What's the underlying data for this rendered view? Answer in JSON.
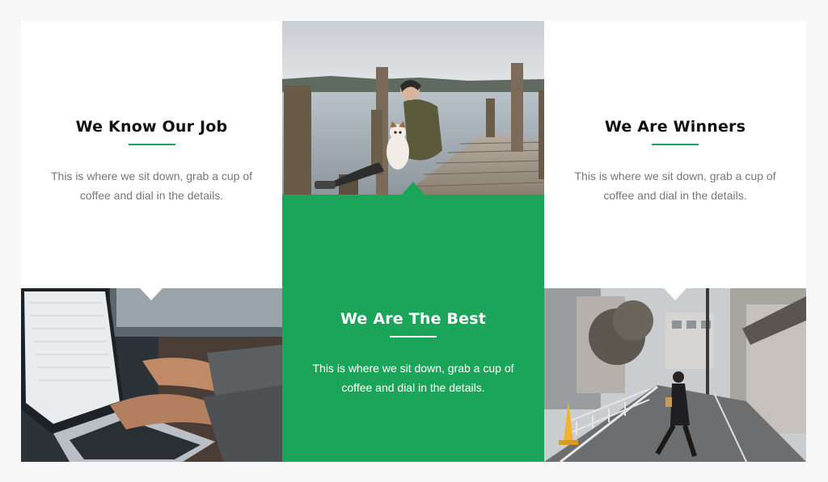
{
  "colors": {
    "accent": "#1aa55a",
    "page_bg": "#f7f7f7"
  },
  "cards": [
    {
      "title": "We Know Our Job",
      "text": "This is where we sit down, grab a cup of coffee and dial in the details."
    },
    {
      "title": "We Are The Best",
      "text": "This is where we sit down, grab a cup of coffee and dial in the details."
    },
    {
      "title": "We Are Winners",
      "text": "This is where we sit down, grab a cup of coffee and dial in the details."
    }
  ],
  "images": {
    "pier": "photo of a person and a dog sitting on a wooden pier by a lake",
    "laptop": "photo of hands typing on a laptop keyboard",
    "street": "photo of a person walking down a narrow city street"
  }
}
